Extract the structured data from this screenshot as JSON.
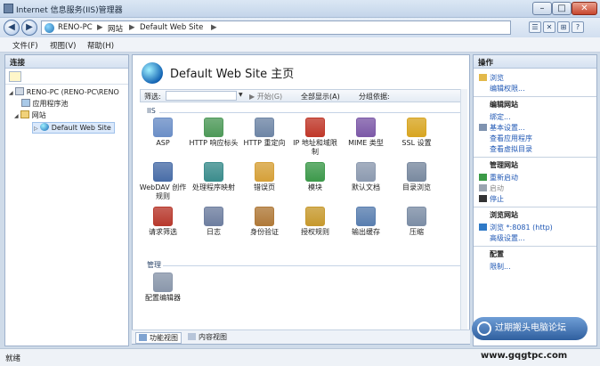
{
  "window": {
    "title": "Internet 信息服务(IIS)管理器",
    "min": "–",
    "max": "□",
    "close": "✕"
  },
  "address": {
    "back": "◀",
    "forward": "▶",
    "crumbs": [
      "RENO-PC",
      "▶",
      "网站",
      "▶",
      "Default Web Site",
      "▶"
    ]
  },
  "toolbar": {
    "icons": [
      "☰",
      "✕",
      "⊞",
      "?"
    ]
  },
  "menu": [
    "文件(F)",
    "视图(V)",
    "帮助(H)"
  ],
  "connections": {
    "header": "连接",
    "tree": [
      {
        "label": "RENO-PC (RENO-PC\\RENO",
        "toggle": "◢",
        "icon": "server-icon"
      },
      {
        "label": "应用程序池",
        "toggle": "",
        "icon": "app-pool-icon"
      },
      {
        "label": "网站",
        "toggle": "◢",
        "icon": "folder-icon"
      },
      {
        "label": "Default Web Site",
        "toggle": "▷",
        "icon": "globe-icon"
      }
    ]
  },
  "main": {
    "title": "Default Web Site 主页",
    "filter": {
      "label": "筛选:",
      "start": "▶ 开始(G)",
      "show_all": "全部显示(A)",
      "group_by": "分组依据:"
    },
    "sections": [
      {
        "name": "IIS",
        "features": [
          {
            "label": "ASP",
            "icon": "asp-icon",
            "color": "#6c8fc7"
          },
          {
            "label": "HTTP 响应标头",
            "icon": "http-headers-icon",
            "color": "#4f9a5a"
          },
          {
            "label": "HTTP 重定向",
            "icon": "http-redirect-icon",
            "color": "#6f86a6"
          },
          {
            "label": "IP 地址和域限制",
            "icon": "ip-restrict-icon",
            "color": "#c0392b"
          },
          {
            "label": "MIME 类型",
            "icon": "mime-icon",
            "color": "#7d5aa8"
          },
          {
            "label": "SSL 设置",
            "icon": "ssl-lock-icon",
            "color": "#d8a623"
          },
          {
            "label": "WebDAV 创作规则",
            "icon": "webdav-icon",
            "color": "#4a6ea8"
          },
          {
            "label": "处理程序映射",
            "icon": "handler-mapping-icon",
            "color": "#3c8d8d"
          },
          {
            "label": "错误页",
            "icon": "error-page-icon",
            "color": "#d6a13a"
          },
          {
            "label": "模块",
            "icon": "modules-icon",
            "color": "#3e9a4c"
          },
          {
            "label": "默认文档",
            "icon": "default-doc-icon",
            "color": "#8d9bb0"
          },
          {
            "label": "目录浏览",
            "icon": "directory-browse-icon",
            "color": "#7a8aa0"
          },
          {
            "label": "请求筛选",
            "icon": "request-filter-icon",
            "color": "#b83a2e"
          },
          {
            "label": "日志",
            "icon": "logging-icon",
            "color": "#6f7fa0"
          },
          {
            "label": "身份验证",
            "icon": "authentication-icon",
            "color": "#b07a3a"
          },
          {
            "label": "授权规则",
            "icon": "authorization-icon",
            "color": "#c79a2f"
          },
          {
            "label": "输出缓存",
            "icon": "output-cache-icon",
            "color": "#5a7fb0"
          },
          {
            "label": "压缩",
            "icon": "compression-icon",
            "color": "#7d8ea6"
          }
        ]
      },
      {
        "name": "管理",
        "features": [
          {
            "label": "配置编辑器",
            "icon": "config-editor-icon",
            "color": "#8a97ab"
          }
        ]
      }
    ],
    "view_tabs": [
      "功能视图",
      "内容视图"
    ]
  },
  "actions": {
    "header": "操作",
    "items": [
      {
        "label": "浏览",
        "kind": "link",
        "icon": "folder-open-icon"
      },
      {
        "label": "编辑权限...",
        "kind": "link",
        "icon": ""
      },
      {
        "label": "编辑网站",
        "kind": "head",
        "icon": ""
      },
      {
        "label": "绑定...",
        "kind": "link",
        "icon": ""
      },
      {
        "label": "基本设置...",
        "kind": "link",
        "icon": "settings-icon"
      },
      {
        "label": "查看应用程序",
        "kind": "link",
        "icon": ""
      },
      {
        "label": "查看虚拟目录",
        "kind": "link",
        "icon": ""
      },
      {
        "label": "管理网站",
        "kind": "head",
        "icon": ""
      },
      {
        "label": "重新启动",
        "kind": "link",
        "icon": "restart-icon"
      },
      {
        "label": "启动",
        "kind": "disabled",
        "icon": "start-icon"
      },
      {
        "label": "停止",
        "kind": "link",
        "icon": "stop-icon"
      },
      {
        "label": "浏览网站",
        "kind": "head",
        "icon": ""
      },
      {
        "label": "浏览 *:8081 (http)",
        "kind": "link",
        "icon": "browse-icon"
      },
      {
        "label": "高级设置...",
        "kind": "link",
        "icon": ""
      },
      {
        "label": "配置",
        "kind": "head",
        "icon": ""
      },
      {
        "label": "限制...",
        "kind": "link",
        "icon": ""
      }
    ]
  },
  "status": "就绪",
  "watermark": {
    "text": "过期搬头电脑论坛",
    "url": "www.gqgtpc.com"
  }
}
